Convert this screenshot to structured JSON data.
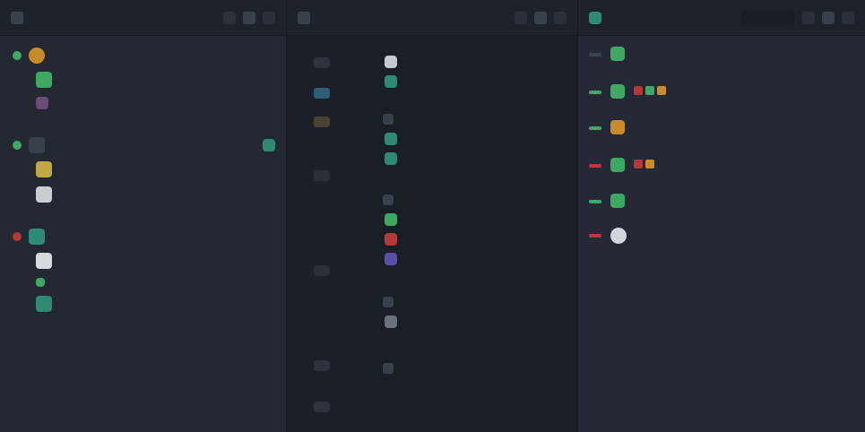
{
  "colors": {
    "green": "#3fa865",
    "orange": "#c98a2a",
    "red": "#b33a3a",
    "purple": "#5b4fa8",
    "teal": "#2f8a74",
    "yellow": "#c2a747",
    "grey": "#7d8490"
  },
  "panels": [
    {
      "title": "",
      "subtitle": ""
    },
    {
      "title": "",
      "subtitle": ""
    },
    {
      "title": "",
      "subtitle": ""
    }
  ],
  "left_groups": [
    {
      "name": "",
      "meta": "",
      "items": [
        {
          "text": "",
          "sub": ""
        },
        {
          "text": "",
          "sub": ""
        }
      ]
    },
    {
      "name": "",
      "meta": "",
      "items": [
        {
          "text": "",
          "sub": ""
        },
        {
          "text": "",
          "sub": ""
        }
      ]
    },
    {
      "name": "",
      "meta": "",
      "items": [
        {
          "text": "",
          "sub": ""
        },
        {
          "text": "",
          "sub": ""
        },
        {
          "text": "",
          "sub": ""
        }
      ]
    }
  ],
  "mid_sections": [
    {
      "name": "",
      "meta": "",
      "items": [
        "",
        ""
      ]
    },
    {
      "name": "",
      "meta": "",
      "items": [
        "",
        ""
      ]
    },
    {
      "name": "",
      "meta": "",
      "items": [
        "",
        "",
        ""
      ]
    },
    {
      "name": "",
      "meta": "",
      "items": [
        ""
      ]
    },
    {
      "name": "",
      "meta": "",
      "items": []
    }
  ],
  "right_cards": [
    {
      "title": "",
      "line2": "",
      "meta": ""
    },
    {
      "title": "",
      "line2": "",
      "meta": ""
    },
    {
      "title": "",
      "line2": "",
      "meta": ""
    },
    {
      "title": "",
      "line2": "",
      "meta": ""
    },
    {
      "title": "",
      "line2": "",
      "meta": ""
    },
    {
      "title": "",
      "line2": "",
      "meta": ""
    }
  ]
}
